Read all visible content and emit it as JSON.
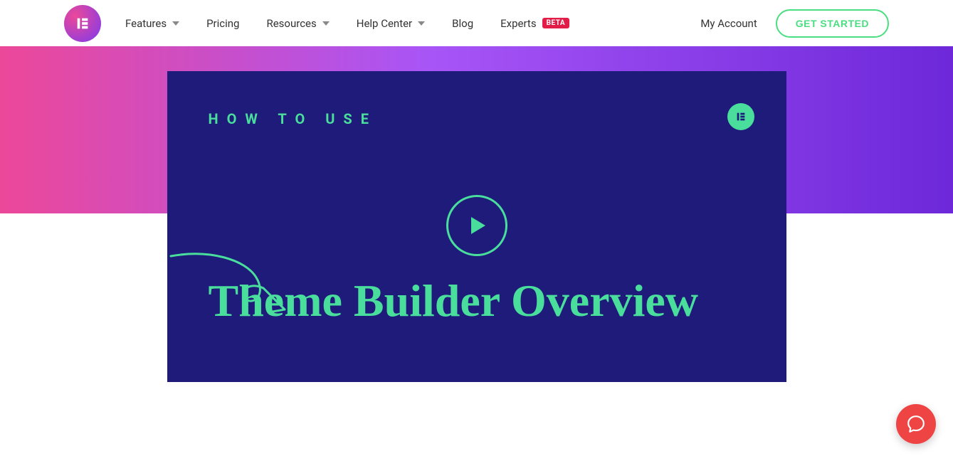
{
  "nav": {
    "features": "Features",
    "pricing": "Pricing",
    "resources": "Resources",
    "help_center": "Help Center",
    "blog": "Blog",
    "experts": "Experts",
    "experts_badge": "BETA"
  },
  "header": {
    "my_account": "My Account",
    "get_started": "GET STARTED"
  },
  "video": {
    "eyebrow": "HOW TO USE",
    "title": "Theme Builder Overview"
  },
  "colors": {
    "accent": "#4ade9d",
    "card_bg": "#1e1b7a",
    "gradient_start": "#ec4899",
    "gradient_end": "#6d28d9",
    "help_bubble": "#ef4444"
  }
}
